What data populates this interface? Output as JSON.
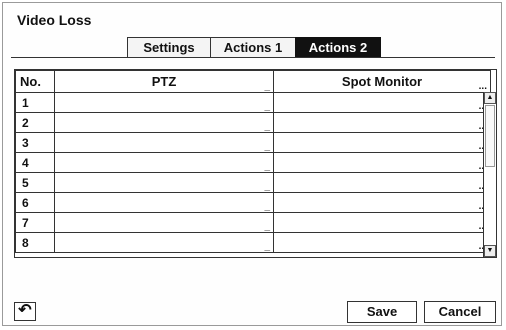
{
  "window": {
    "title": "Video Loss"
  },
  "tabs": [
    {
      "label": "Settings",
      "active": false
    },
    {
      "label": "Actions 1",
      "active": false
    },
    {
      "label": "Actions 2",
      "active": true
    }
  ],
  "table": {
    "headers": {
      "no": "No.",
      "ptz": "PTZ",
      "spot": "Spot Monitor"
    },
    "rows": [
      {
        "no": "1",
        "ptz": "",
        "spot": ""
      },
      {
        "no": "2",
        "ptz": "",
        "spot": ""
      },
      {
        "no": "3",
        "ptz": "",
        "spot": ""
      },
      {
        "no": "4",
        "ptz": "",
        "spot": ""
      },
      {
        "no": "5",
        "ptz": "",
        "spot": ""
      },
      {
        "no": "6",
        "ptz": "",
        "spot": ""
      },
      {
        "no": "7",
        "ptz": "",
        "spot": ""
      },
      {
        "no": "8",
        "ptz": "",
        "spot": ""
      }
    ],
    "ptz_cell_marker": "_",
    "spot_cell_marker": "...",
    "header_marker": "..."
  },
  "icons": {
    "back": "back-arrow-icon",
    "scroll_up": "scroll-up-icon",
    "scroll_down": "scroll-down-icon"
  },
  "buttons": {
    "save": "Save",
    "cancel": "Cancel"
  }
}
